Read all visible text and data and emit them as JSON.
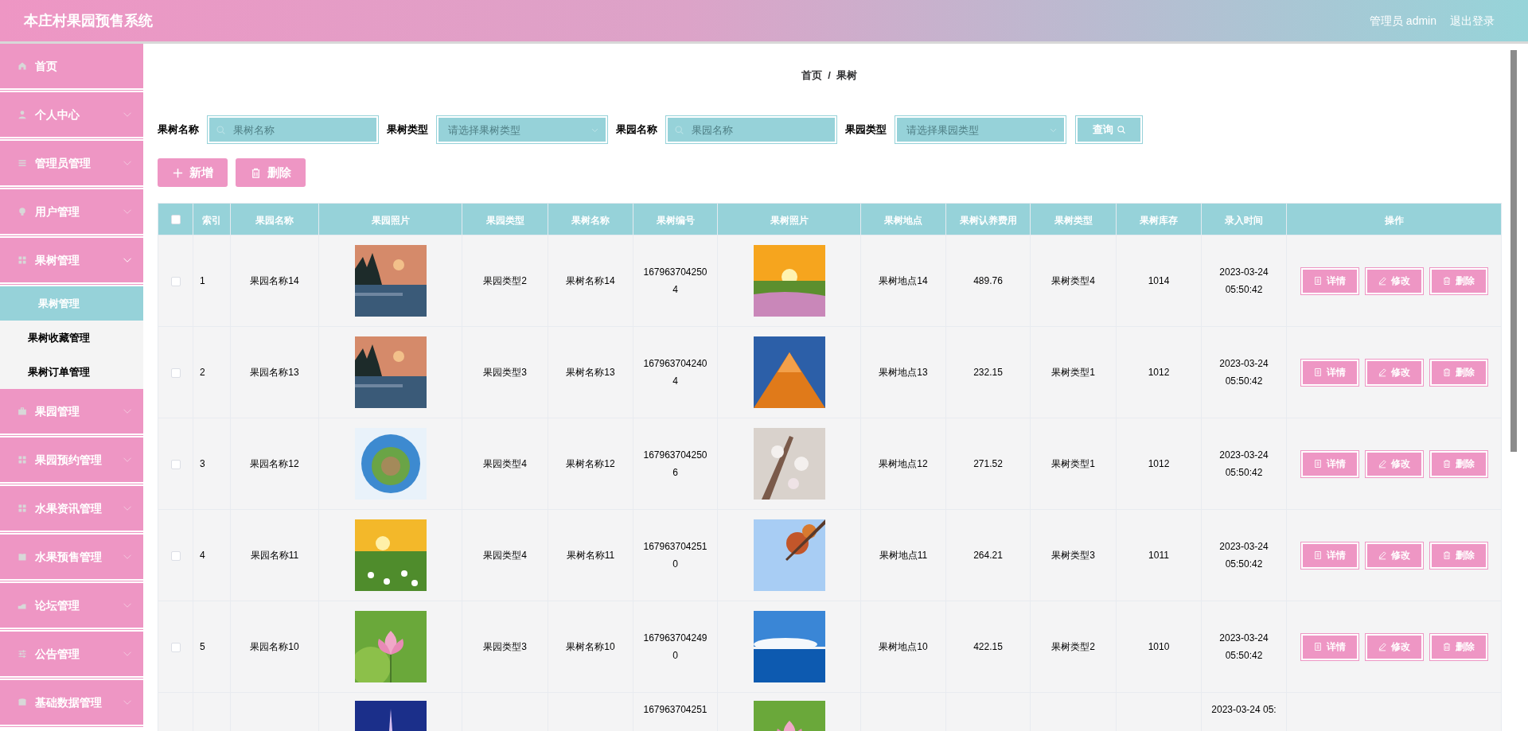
{
  "header": {
    "title": "本庄村果园预售系统",
    "user": "管理员 admin",
    "logout": "退出登录"
  },
  "sidebar": {
    "items": [
      {
        "label": "首页",
        "expanded": false
      },
      {
        "label": "个人中心",
        "expanded": false
      },
      {
        "label": "管理员管理",
        "expanded": false
      },
      {
        "label": "用户管理",
        "expanded": false
      },
      {
        "label": "果树管理",
        "expanded": true,
        "children": [
          {
            "label": "果树管理",
            "selected": true
          },
          {
            "label": "果树收藏管理",
            "selected": false
          },
          {
            "label": "果树订单管理",
            "selected": false
          }
        ]
      },
      {
        "label": "果园管理",
        "expanded": false
      },
      {
        "label": "果园预约管理",
        "expanded": false
      },
      {
        "label": "水果资讯管理",
        "expanded": false
      },
      {
        "label": "水果预售管理",
        "expanded": false
      },
      {
        "label": "论坛管理",
        "expanded": false
      },
      {
        "label": "公告管理",
        "expanded": false
      },
      {
        "label": "基础数据管理",
        "expanded": false
      }
    ]
  },
  "breadcrumb": [
    "首页",
    "/",
    "果树"
  ],
  "search": {
    "fields": [
      {
        "label": "果树名称",
        "kind": "text",
        "placeholder": "果树名称"
      },
      {
        "label": "果树类型",
        "kind": "select",
        "placeholder": "请选择果树类型"
      },
      {
        "label": "果园名称",
        "kind": "text",
        "placeholder": "果园名称"
      },
      {
        "label": "果园类型",
        "kind": "select",
        "placeholder": "请选择果园类型"
      }
    ],
    "button": "查询"
  },
  "toolbar": [
    {
      "label": "新增",
      "kind": "add"
    },
    {
      "label": "删除",
      "kind": "delete"
    }
  ],
  "table": {
    "header_checked": false,
    "columns": [
      "索引",
      "果园名称",
      "果园照片",
      "果园类型",
      "果树名称",
      "果树编号",
      "果树照片",
      "果树地点",
      "果树认养费用",
      "果树类型",
      "果树库存",
      "录入时间",
      "操作"
    ],
    "rows": [
      {
        "checked": false,
        "index": "1",
        "orchard_name": "果园名称14",
        "orchard_type": "果园类型2",
        "tree_name": "果树名称14",
        "code": "1679637042504",
        "place": "果树地点14",
        "fee": "489.76",
        "tree_type": "果树类型4",
        "stock": "1014",
        "time": "2023-03-24 05:50:42",
        "actions": [
          "详情",
          "修改",
          "删除"
        ]
      },
      {
        "checked": false,
        "index": "2",
        "orchard_name": "果园名称13",
        "orchard_type": "果园类型3",
        "tree_name": "果树名称13",
        "code": "1679637042404",
        "place": "果树地点13",
        "fee": "232.15",
        "tree_type": "果树类型1",
        "stock": "1012",
        "time": "2023-03-24 05:50:42",
        "actions": [
          "详情",
          "修改",
          "删除"
        ]
      },
      {
        "checked": false,
        "index": "3",
        "orchard_name": "果园名称12",
        "orchard_type": "果园类型4",
        "tree_name": "果树名称12",
        "code": "1679637042506",
        "place": "果树地点12",
        "fee": "271.52",
        "tree_type": "果树类型1",
        "stock": "1012",
        "time": "2023-03-24 05:50:42",
        "actions": [
          "详情",
          "修改",
          "删除"
        ]
      },
      {
        "checked": false,
        "index": "4",
        "orchard_name": "果园名称11",
        "orchard_type": "果园类型4",
        "tree_name": "果树名称11",
        "code": "1679637042510",
        "place": "果树地点11",
        "fee": "264.21",
        "tree_type": "果树类型3",
        "stock": "1011",
        "time": "2023-03-24 05:50:42",
        "actions": [
          "详情",
          "修改",
          "删除"
        ]
      },
      {
        "checked": false,
        "index": "5",
        "orchard_name": "果园名称10",
        "orchard_type": "果园类型3",
        "tree_name": "果树名称10",
        "code": "1679637042490",
        "place": "果树地点10",
        "fee": "422.15",
        "tree_type": "果树类型2",
        "stock": "1010",
        "time": "2023-03-24 05:50:42",
        "actions": [
          "详情",
          "修改",
          "删除"
        ]
      },
      {
        "code": "167963704251",
        "time": "2023-03-24 05:"
      }
    ]
  }
}
